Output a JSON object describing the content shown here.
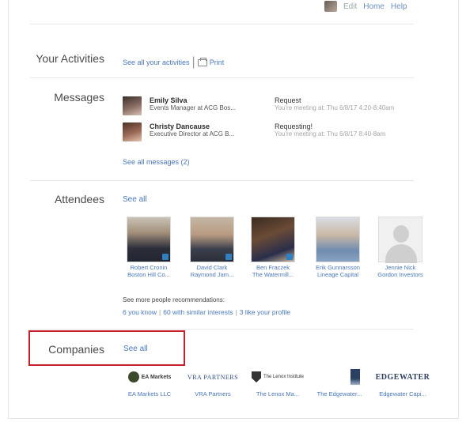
{
  "topbar": {
    "links": [
      "Edit",
      "Home",
      "Help"
    ]
  },
  "activities": {
    "title": "Your Activities",
    "see_all": "See all your activities",
    "print": "Print"
  },
  "messages": {
    "title": "Messages",
    "items": [
      {
        "name": "Emily Silva",
        "subtitle": "Events Manager at ACG Bos...",
        "label": "Request",
        "snippet": "You're meeting at: Thu 6/8/17 4:20-8:40am"
      },
      {
        "name": "Christy Dancause",
        "subtitle": "Executive Director at ACG B...",
        "label": "Requesting!",
        "snippet": "You're meeting at: Thu 6/8/17 8:40-8am"
      }
    ],
    "see_all": "See all messages (2)"
  },
  "attendees": {
    "title": "Attendees",
    "see_all": "See all",
    "people": [
      {
        "name_line1": "Robert Cronin",
        "name_line2": "Boston Hill Co..."
      },
      {
        "name_line1": "David Clark",
        "name_line2": "Raymond Jam..."
      },
      {
        "name_line1": "Ben Fraczek",
        "name_line2": "The Watermill..."
      },
      {
        "name_line1": "Erik Gunnarsson",
        "name_line2": "Lineage Capital"
      },
      {
        "name_line1": "Jennie Nick",
        "name_line2": "Gordon Investors"
      }
    ],
    "recommendations_label": "See more people recommendations:",
    "rec_links": [
      "6 you know",
      "60 with similar interests",
      "3 like your profile"
    ]
  },
  "companies": {
    "title": "Companies",
    "see_all": "See all",
    "items": [
      {
        "logo_text": "EA Markets",
        "name": "EA Markets LLC"
      },
      {
        "logo_text": "VRA PARTNERS",
        "name": "VRA Partners"
      },
      {
        "logo_text": "The Lenox Institute",
        "name": "The Lenox Ma..."
      },
      {
        "logo_text": "",
        "name": "The Edgewater..."
      },
      {
        "logo_text": "EDGEWATER",
        "name": "Edgewater Capi..."
      }
    ]
  }
}
